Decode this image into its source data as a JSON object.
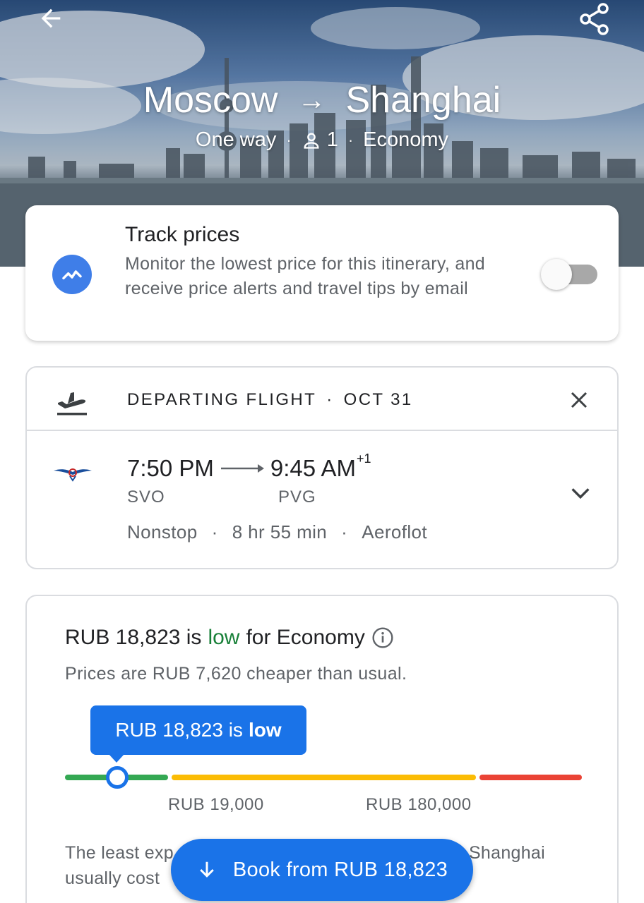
{
  "header": {
    "back_icon": "arrow-left-icon",
    "share_icon": "share-icon",
    "origin": "Moscow",
    "arrow": "→",
    "destination": "Shanghai",
    "trip_type": "One way",
    "passengers": "1",
    "cabin": "Economy",
    "separator": "·"
  },
  "track_prices": {
    "title": "Track prices",
    "description": "Monitor the lowest price for this itinerary, and receive price alerts and travel tips by email",
    "toggle_on": false
  },
  "flight": {
    "heading": "DEPARTING FLIGHT",
    "date": "OCT 31",
    "separator": "·",
    "depart_time": "7:50 PM",
    "arrive_time": "9:45 AM",
    "day_offset": "+1",
    "depart_airport": "SVO",
    "arrive_airport": "PVG",
    "stops": "Nonstop",
    "duration": "8 hr 55 min",
    "airline": "Aeroflot"
  },
  "price_insight": {
    "price": "RUB 18,823 is",
    "level": "low",
    "suffix": "for Economy",
    "subtitle": "Prices are RUB 7,620 cheaper than usual.",
    "tooltip_price": "RUB 18,823 is",
    "tooltip_level": "low",
    "range_low_label": "RUB 19,000",
    "range_high_label": "RUB 180,000",
    "least_line1_a": "The least exp",
    "least_line1_b": "Shanghai",
    "least_line2": "usually cost",
    "colors": {
      "low": "#34a853",
      "typical": "#fbbc04",
      "high": "#ea4335",
      "accent": "#1a73e8"
    }
  },
  "book_button": {
    "label": "Book from RUB 18,823",
    "icon": "arrow-down-icon"
  }
}
